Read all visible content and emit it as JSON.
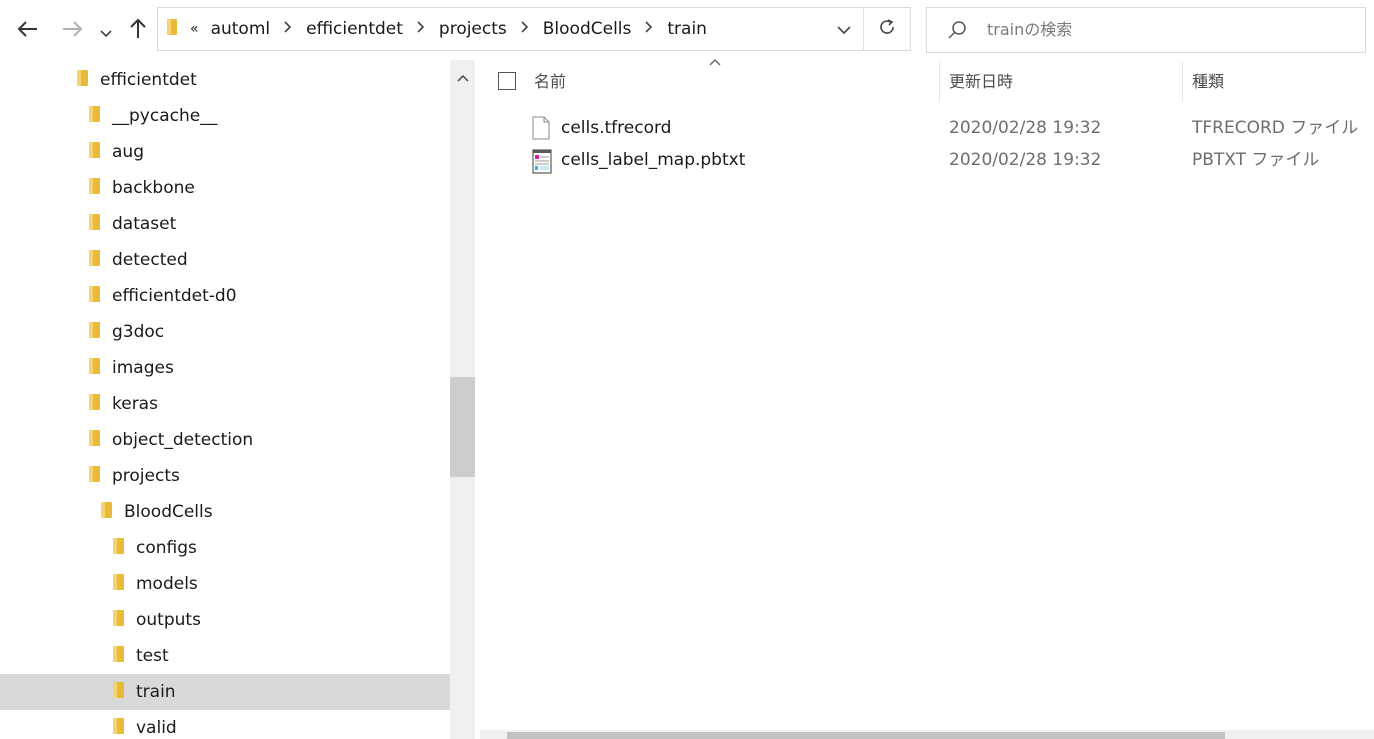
{
  "toolbar": {
    "back_icon": "back-arrow-icon",
    "forward_icon": "forward-arrow-icon",
    "recent_icon": "chevron-down-icon",
    "up_icon": "up-arrow-icon"
  },
  "address_bar": {
    "overflow": "«",
    "crumbs": [
      "automl",
      "efficientdet",
      "projects",
      "BloodCells",
      "train"
    ]
  },
  "search": {
    "placeholder": "trainの検索"
  },
  "nav_tree": {
    "items": [
      {
        "label": "efficientdet",
        "level": 0,
        "selected": false
      },
      {
        "label": "__pycache__",
        "level": 1,
        "selected": false
      },
      {
        "label": "aug",
        "level": 1,
        "selected": false
      },
      {
        "label": "backbone",
        "level": 1,
        "selected": false
      },
      {
        "label": "dataset",
        "level": 1,
        "selected": false
      },
      {
        "label": "detected",
        "level": 1,
        "selected": false
      },
      {
        "label": "efficientdet-d0",
        "level": 1,
        "selected": false
      },
      {
        "label": "g3doc",
        "level": 1,
        "selected": false
      },
      {
        "label": "images",
        "level": 1,
        "selected": false
      },
      {
        "label": "keras",
        "level": 1,
        "selected": false
      },
      {
        "label": "object_detection",
        "level": 1,
        "selected": false
      },
      {
        "label": "projects",
        "level": 1,
        "selected": false
      },
      {
        "label": "BloodCells",
        "level": 2,
        "selected": false
      },
      {
        "label": "configs",
        "level": 3,
        "selected": false
      },
      {
        "label": "models",
        "level": 3,
        "selected": false
      },
      {
        "label": "outputs",
        "level": 3,
        "selected": false
      },
      {
        "label": "test",
        "level": 3,
        "selected": false
      },
      {
        "label": "train",
        "level": 3,
        "selected": true
      },
      {
        "label": "valid",
        "level": 3,
        "selected": false
      }
    ]
  },
  "columns": {
    "name": "名前",
    "modified": "更新日時",
    "type": "種類"
  },
  "files": [
    {
      "name": "cells.tfrecord",
      "modified": "2020/02/28 19:32",
      "type": "TFRECORD ファイル",
      "icon": "blank-file-icon"
    },
    {
      "name": "cells_label_map.pbtxt",
      "modified": "2020/02/28 19:32",
      "type": "PBTXT ファイル",
      "icon": "notepad-file-icon"
    }
  ],
  "colors": {
    "folder": "#e8b93a",
    "selection": "#d9d9d9"
  }
}
